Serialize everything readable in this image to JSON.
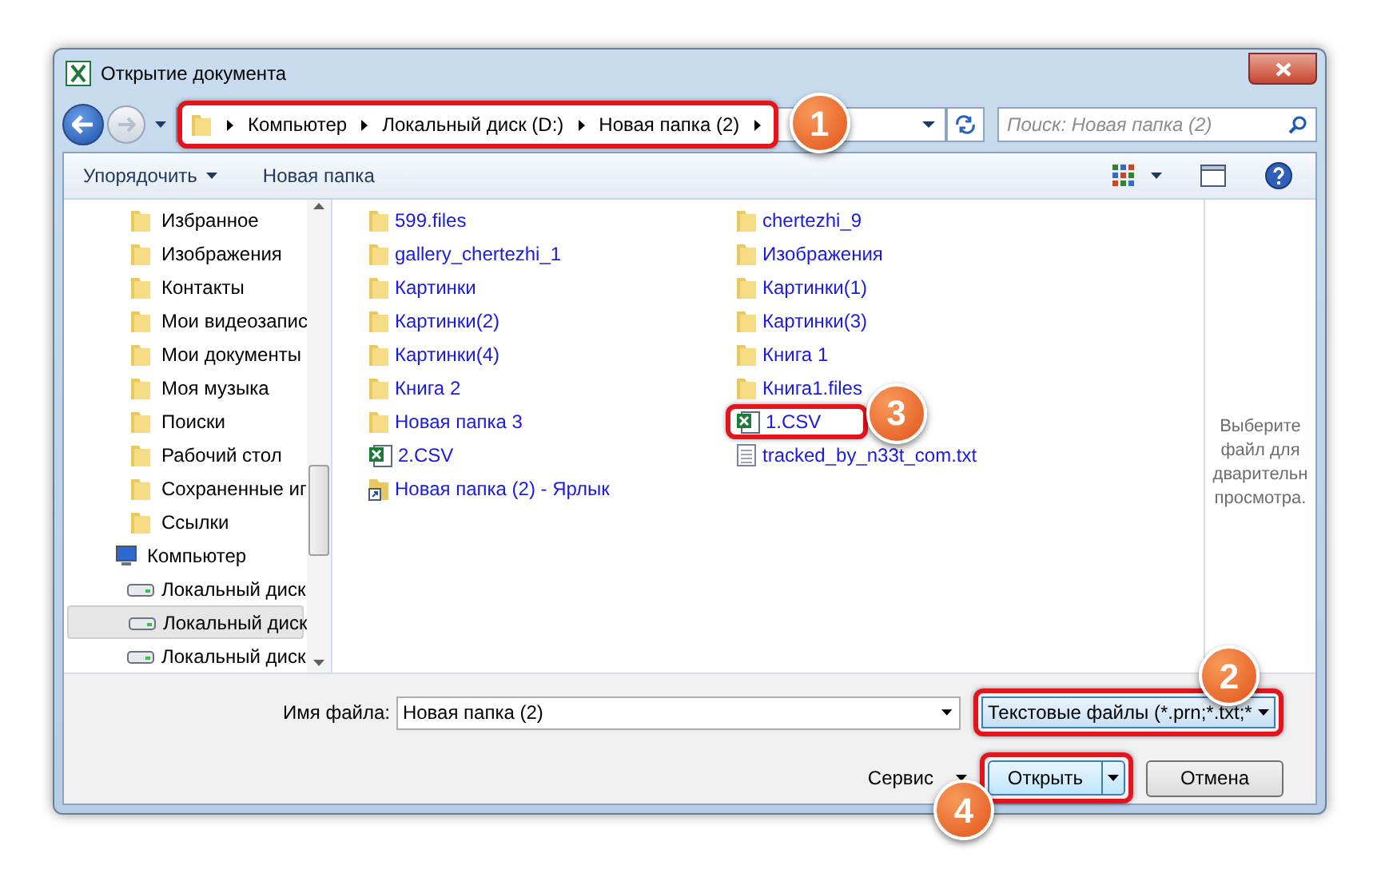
{
  "window": {
    "title": "Открытие документа"
  },
  "address_bar": {
    "breadcrumbs": [
      "Компьютер",
      "Локальный диск (D:)",
      "Новая папка (2)"
    ],
    "callout": "1"
  },
  "search": {
    "placeholder": "Поиск: Новая папка (2)"
  },
  "toolbar": {
    "organize": "Упорядочить",
    "new_folder": "Новая папка"
  },
  "nav": {
    "items": [
      {
        "label": "Избранное",
        "selected": false
      },
      {
        "label": "Изображения",
        "selected": false
      },
      {
        "label": "Контакты",
        "selected": false
      },
      {
        "label": "Мои видеозапис",
        "selected": false
      },
      {
        "label": "Мои документы",
        "selected": false
      },
      {
        "label": "Моя музыка",
        "selected": false
      },
      {
        "label": "Поиски",
        "selected": false
      },
      {
        "label": "Рабочий стол",
        "selected": false
      },
      {
        "label": "Сохраненные иг",
        "selected": false
      },
      {
        "label": "Ссылки",
        "selected": false
      }
    ],
    "computer": {
      "label": "Компьютер",
      "selected": false,
      "children": [
        {
          "label": "Локальный диск",
          "selected": false
        },
        {
          "label": "Локальный диск",
          "selected": true
        },
        {
          "label": "Локальный диск",
          "selected": false
        }
      ]
    }
  },
  "files": [
    {
      "name": "599.files",
      "kind": "folder"
    },
    {
      "name": "gallery_chertezhi_1",
      "kind": "folder"
    },
    {
      "name": "Картинки",
      "kind": "folder"
    },
    {
      "name": "Картинки(2)",
      "kind": "folder"
    },
    {
      "name": "Картинки(4)",
      "kind": "folder"
    },
    {
      "name": "Книга 2",
      "kind": "folder"
    },
    {
      "name": "Новая папка 3",
      "kind": "folder"
    },
    {
      "name": "2.CSV",
      "kind": "excel"
    },
    {
      "name": "Новая папка (2) - Ярлык",
      "kind": "shortcut"
    },
    {
      "name": "chertezhi_9",
      "kind": "folder"
    },
    {
      "name": "Изображения",
      "kind": "folder"
    },
    {
      "name": "Картинки(1)",
      "kind": "folder"
    },
    {
      "name": "Картинки(3)",
      "kind": "folder"
    },
    {
      "name": "Книга 1",
      "kind": "folder"
    },
    {
      "name": "Книга1.files",
      "kind": "folder"
    },
    {
      "name": "1.CSV",
      "kind": "excel",
      "callout": "3"
    },
    {
      "name": "tracked_by_n33t_com.txt",
      "kind": "text"
    }
  ],
  "preview": [
    "Выберите",
    "файл для",
    "дварительн",
    "просмотра."
  ],
  "filename": {
    "label": "Имя файла:",
    "value": "Новая папка (2)"
  },
  "filter": {
    "value": "Текстовые файлы (*.prn;*.txt;*",
    "callout": "2"
  },
  "tools": "Сервис",
  "open_button": {
    "label": "Открыть",
    "callout": "4"
  },
  "cancel_button": "Отмена"
}
